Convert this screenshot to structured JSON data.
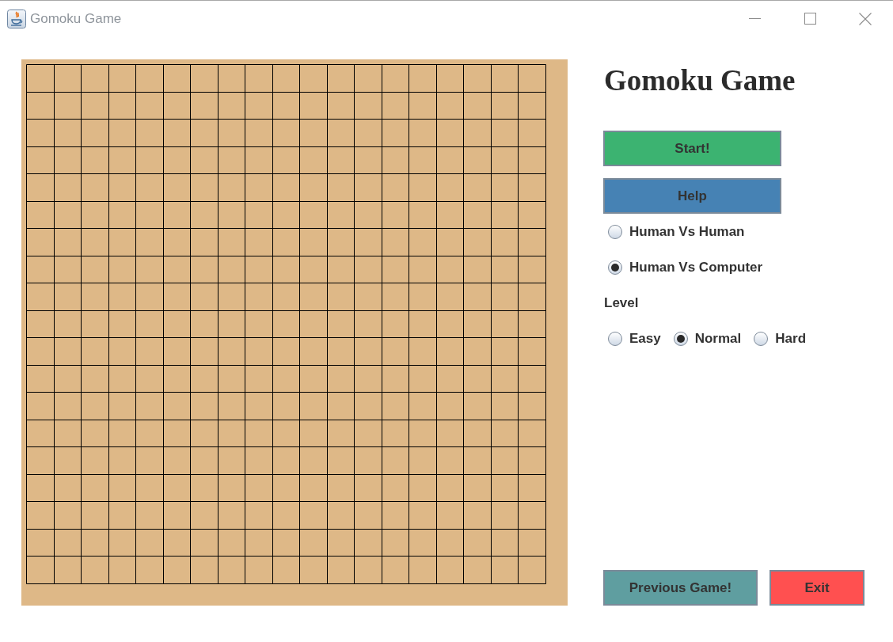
{
  "window": {
    "title": "Gomoku Game"
  },
  "panel": {
    "heading": "Gomoku Game",
    "buttons": [
      {
        "label": "Start!",
        "color": "#3cb371"
      },
      {
        "label": "Help",
        "color": "#4682b4"
      }
    ],
    "game_modes": [
      {
        "label": "Human Vs Human",
        "selected": false
      },
      {
        "label": "Human Vs Computer",
        "selected": true
      }
    ],
    "level": {
      "label": "Level",
      "options": [
        {
          "label": "Easy",
          "selected": false
        },
        {
          "label": "Normal",
          "selected": true
        },
        {
          "label": "Hard",
          "selected": false
        }
      ]
    },
    "bottom_buttons": [
      {
        "label": "Previous Game!",
        "color": "#5f9ea0"
      },
      {
        "label": "Exit",
        "color": "#ff5050"
      }
    ]
  }
}
